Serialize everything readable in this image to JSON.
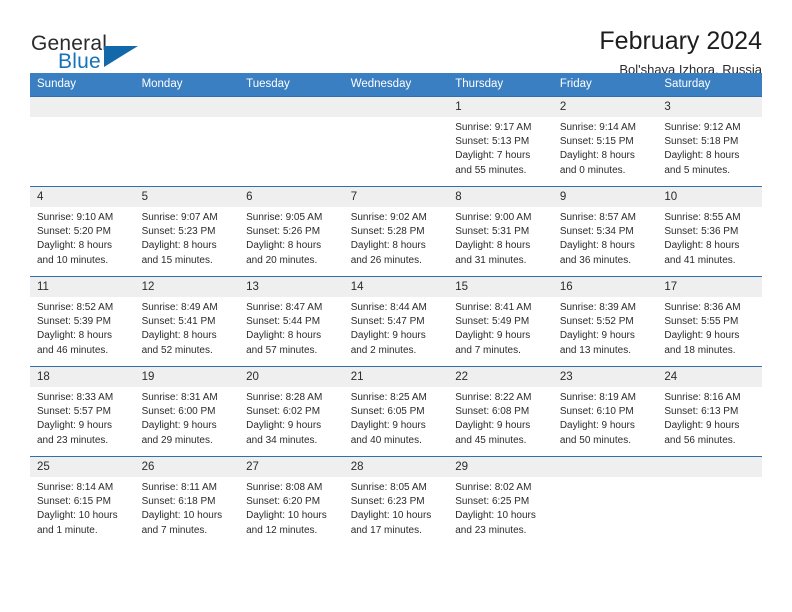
{
  "brand": {
    "line1": "General",
    "line2": "Blue",
    "accent_color": "#1573ba",
    "triangle_color": "#1268a8"
  },
  "header": {
    "title": "February 2024",
    "subtitle": "Bol'shaya Izhora, Russia",
    "header_bg": "#3a7fc1",
    "row_border_color": "#2f6fac",
    "day_band_bg": "#efefef"
  },
  "weekdays": [
    "Sunday",
    "Monday",
    "Tuesday",
    "Wednesday",
    "Thursday",
    "Friday",
    "Saturday"
  ],
  "weeks": [
    [
      {
        "day": "",
        "sunrise": "",
        "sunset": "",
        "daylight1": "",
        "daylight2": ""
      },
      {
        "day": "",
        "sunrise": "",
        "sunset": "",
        "daylight1": "",
        "daylight2": ""
      },
      {
        "day": "",
        "sunrise": "",
        "sunset": "",
        "daylight1": "",
        "daylight2": ""
      },
      {
        "day": "",
        "sunrise": "",
        "sunset": "",
        "daylight1": "",
        "daylight2": ""
      },
      {
        "day": "1",
        "sunrise": "Sunrise: 9:17 AM",
        "sunset": "Sunset: 5:13 PM",
        "daylight1": "Daylight: 7 hours",
        "daylight2": "and 55 minutes."
      },
      {
        "day": "2",
        "sunrise": "Sunrise: 9:14 AM",
        "sunset": "Sunset: 5:15 PM",
        "daylight1": "Daylight: 8 hours",
        "daylight2": "and 0 minutes."
      },
      {
        "day": "3",
        "sunrise": "Sunrise: 9:12 AM",
        "sunset": "Sunset: 5:18 PM",
        "daylight1": "Daylight: 8 hours",
        "daylight2": "and 5 minutes."
      }
    ],
    [
      {
        "day": "4",
        "sunrise": "Sunrise: 9:10 AM",
        "sunset": "Sunset: 5:20 PM",
        "daylight1": "Daylight: 8 hours",
        "daylight2": "and 10 minutes."
      },
      {
        "day": "5",
        "sunrise": "Sunrise: 9:07 AM",
        "sunset": "Sunset: 5:23 PM",
        "daylight1": "Daylight: 8 hours",
        "daylight2": "and 15 minutes."
      },
      {
        "day": "6",
        "sunrise": "Sunrise: 9:05 AM",
        "sunset": "Sunset: 5:26 PM",
        "daylight1": "Daylight: 8 hours",
        "daylight2": "and 20 minutes."
      },
      {
        "day": "7",
        "sunrise": "Sunrise: 9:02 AM",
        "sunset": "Sunset: 5:28 PM",
        "daylight1": "Daylight: 8 hours",
        "daylight2": "and 26 minutes."
      },
      {
        "day": "8",
        "sunrise": "Sunrise: 9:00 AM",
        "sunset": "Sunset: 5:31 PM",
        "daylight1": "Daylight: 8 hours",
        "daylight2": "and 31 minutes."
      },
      {
        "day": "9",
        "sunrise": "Sunrise: 8:57 AM",
        "sunset": "Sunset: 5:34 PM",
        "daylight1": "Daylight: 8 hours",
        "daylight2": "and 36 minutes."
      },
      {
        "day": "10",
        "sunrise": "Sunrise: 8:55 AM",
        "sunset": "Sunset: 5:36 PM",
        "daylight1": "Daylight: 8 hours",
        "daylight2": "and 41 minutes."
      }
    ],
    [
      {
        "day": "11",
        "sunrise": "Sunrise: 8:52 AM",
        "sunset": "Sunset: 5:39 PM",
        "daylight1": "Daylight: 8 hours",
        "daylight2": "and 46 minutes."
      },
      {
        "day": "12",
        "sunrise": "Sunrise: 8:49 AM",
        "sunset": "Sunset: 5:41 PM",
        "daylight1": "Daylight: 8 hours",
        "daylight2": "and 52 minutes."
      },
      {
        "day": "13",
        "sunrise": "Sunrise: 8:47 AM",
        "sunset": "Sunset: 5:44 PM",
        "daylight1": "Daylight: 8 hours",
        "daylight2": "and 57 minutes."
      },
      {
        "day": "14",
        "sunrise": "Sunrise: 8:44 AM",
        "sunset": "Sunset: 5:47 PM",
        "daylight1": "Daylight: 9 hours",
        "daylight2": "and 2 minutes."
      },
      {
        "day": "15",
        "sunrise": "Sunrise: 8:41 AM",
        "sunset": "Sunset: 5:49 PM",
        "daylight1": "Daylight: 9 hours",
        "daylight2": "and 7 minutes."
      },
      {
        "day": "16",
        "sunrise": "Sunrise: 8:39 AM",
        "sunset": "Sunset: 5:52 PM",
        "daylight1": "Daylight: 9 hours",
        "daylight2": "and 13 minutes."
      },
      {
        "day": "17",
        "sunrise": "Sunrise: 8:36 AM",
        "sunset": "Sunset: 5:55 PM",
        "daylight1": "Daylight: 9 hours",
        "daylight2": "and 18 minutes."
      }
    ],
    [
      {
        "day": "18",
        "sunrise": "Sunrise: 8:33 AM",
        "sunset": "Sunset: 5:57 PM",
        "daylight1": "Daylight: 9 hours",
        "daylight2": "and 23 minutes."
      },
      {
        "day": "19",
        "sunrise": "Sunrise: 8:31 AM",
        "sunset": "Sunset: 6:00 PM",
        "daylight1": "Daylight: 9 hours",
        "daylight2": "and 29 minutes."
      },
      {
        "day": "20",
        "sunrise": "Sunrise: 8:28 AM",
        "sunset": "Sunset: 6:02 PM",
        "daylight1": "Daylight: 9 hours",
        "daylight2": "and 34 minutes."
      },
      {
        "day": "21",
        "sunrise": "Sunrise: 8:25 AM",
        "sunset": "Sunset: 6:05 PM",
        "daylight1": "Daylight: 9 hours",
        "daylight2": "and 40 minutes."
      },
      {
        "day": "22",
        "sunrise": "Sunrise: 8:22 AM",
        "sunset": "Sunset: 6:08 PM",
        "daylight1": "Daylight: 9 hours",
        "daylight2": "and 45 minutes."
      },
      {
        "day": "23",
        "sunrise": "Sunrise: 8:19 AM",
        "sunset": "Sunset: 6:10 PM",
        "daylight1": "Daylight: 9 hours",
        "daylight2": "and 50 minutes."
      },
      {
        "day": "24",
        "sunrise": "Sunrise: 8:16 AM",
        "sunset": "Sunset: 6:13 PM",
        "daylight1": "Daylight: 9 hours",
        "daylight2": "and 56 minutes."
      }
    ],
    [
      {
        "day": "25",
        "sunrise": "Sunrise: 8:14 AM",
        "sunset": "Sunset: 6:15 PM",
        "daylight1": "Daylight: 10 hours",
        "daylight2": "and 1 minute."
      },
      {
        "day": "26",
        "sunrise": "Sunrise: 8:11 AM",
        "sunset": "Sunset: 6:18 PM",
        "daylight1": "Daylight: 10 hours",
        "daylight2": "and 7 minutes."
      },
      {
        "day": "27",
        "sunrise": "Sunrise: 8:08 AM",
        "sunset": "Sunset: 6:20 PM",
        "daylight1": "Daylight: 10 hours",
        "daylight2": "and 12 minutes."
      },
      {
        "day": "28",
        "sunrise": "Sunrise: 8:05 AM",
        "sunset": "Sunset: 6:23 PM",
        "daylight1": "Daylight: 10 hours",
        "daylight2": "and 17 minutes."
      },
      {
        "day": "29",
        "sunrise": "Sunrise: 8:02 AM",
        "sunset": "Sunset: 6:25 PM",
        "daylight1": "Daylight: 10 hours",
        "daylight2": "and 23 minutes."
      },
      {
        "day": "",
        "sunrise": "",
        "sunset": "",
        "daylight1": "",
        "daylight2": ""
      },
      {
        "day": "",
        "sunrise": "",
        "sunset": "",
        "daylight1": "",
        "daylight2": ""
      }
    ]
  ]
}
